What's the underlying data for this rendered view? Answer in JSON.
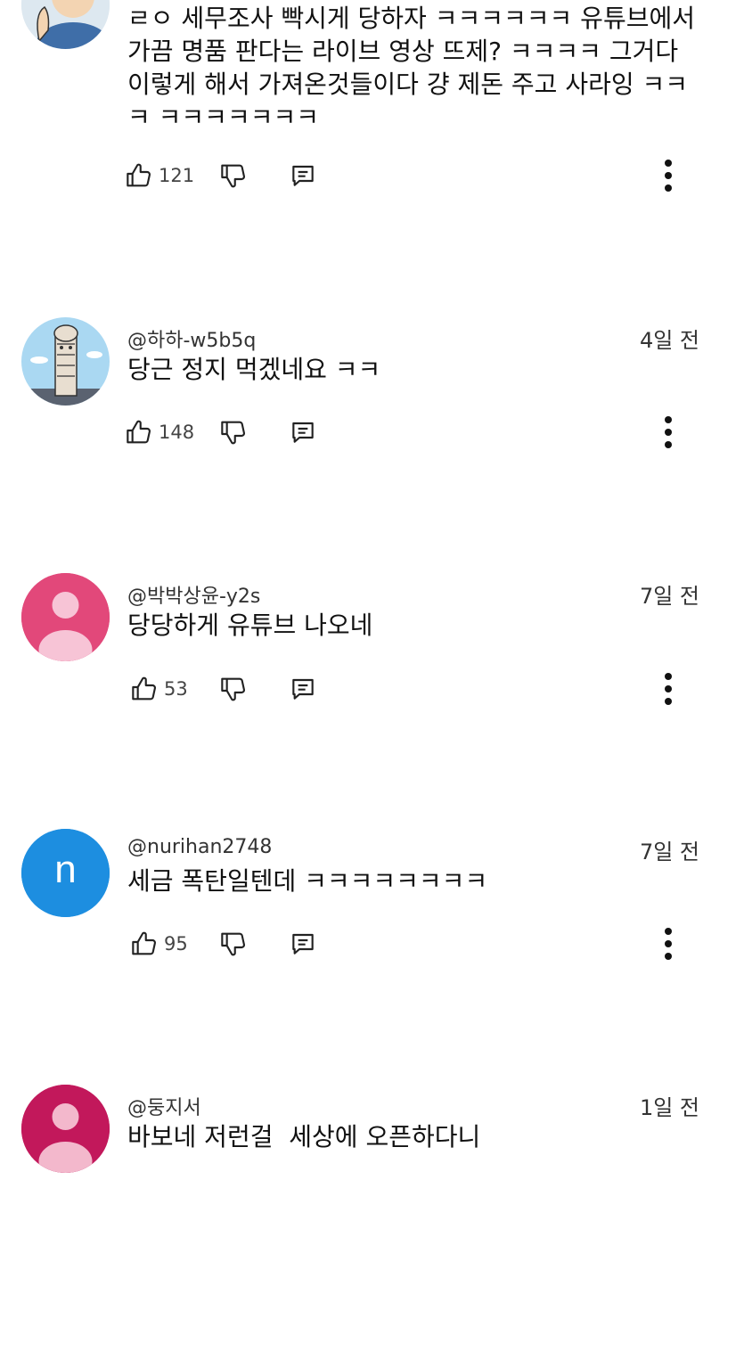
{
  "comments": [
    {
      "handle": "",
      "time": "",
      "text": "ㄹㅇ 세무조사 빡시게 당하자 ㅋㅋㅋㅋㅋㅋ 유튜브에서 가끔 명품 판다는 라이브 영상 뜨제? ㅋㅋㅋㅋ 그거다 이렇게 해서 가져온것들이다 걍 제돈 주고 사라잉 ㅋㅋㅋ ㅋㅋㅋㅋㅋㅋㅋ",
      "likes": "121",
      "avatar": "illustrated-person"
    },
    {
      "handle": "@하하-w5b5q",
      "time": "4일 전",
      "text": "당근 정지 먹겠네요 ㅋㅋ",
      "likes": "148",
      "avatar": "statue-illustration"
    },
    {
      "handle": "@박박상윤-y2s",
      "time": "7일 전",
      "text": "당당하게 유튜브 나오네",
      "likes": "53",
      "avatar": "default-person",
      "avatar_color": "#e2487a"
    },
    {
      "handle": "@nurihan2748",
      "time": "7일 전",
      "text": "세금 폭탄일텐데 ㅋㅋㅋㅋㅋㅋㅋㅋ",
      "likes": "95",
      "avatar": "letter",
      "avatar_letter": "n",
      "avatar_color": "#1d8ee0"
    },
    {
      "handle": "@둥지서",
      "time": "1일 전",
      "text": "바보네 저런걸  세상에 오픈하다니",
      "likes": "",
      "avatar": "default-person",
      "avatar_color": "#c2185b"
    }
  ],
  "icons": {
    "like": "thumb-up-icon",
    "dislike": "thumb-down-icon",
    "reply": "reply-icon",
    "more": "more-vert-icon"
  }
}
